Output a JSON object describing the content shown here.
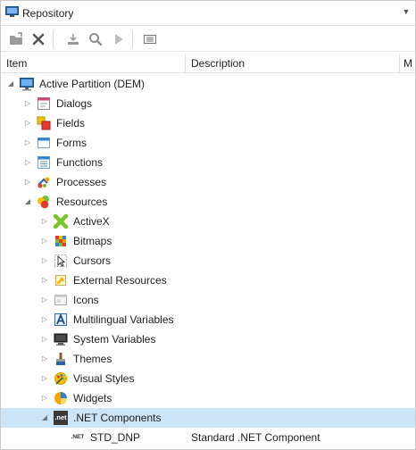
{
  "window": {
    "title": "Repository",
    "dropdown_icon": "chevron-down-icon"
  },
  "toolbar": {
    "buttons": [
      {
        "name": "new-item-button",
        "icon": "open-folder-icon"
      },
      {
        "name": "delete-button",
        "icon": "close-icon"
      },
      {
        "name": "import-button",
        "icon": "download-icon"
      },
      {
        "name": "find-button",
        "icon": "search-icon"
      },
      {
        "name": "run-button",
        "icon": "play-icon"
      },
      {
        "name": "properties-button",
        "icon": "list-icon"
      }
    ]
  },
  "columns": {
    "item": "Item",
    "description": "Description",
    "more": "M"
  },
  "tree": {
    "root": {
      "label": "Active Partition (DEM)",
      "icon": "monitor-icon",
      "expanded": true
    },
    "level1": [
      {
        "label": "Dialogs",
        "icon": "dialog-icon",
        "expanded": false
      },
      {
        "label": "Fields",
        "icon": "fields-icon",
        "expanded": false
      },
      {
        "label": "Forms",
        "icon": "form-icon",
        "expanded": false
      },
      {
        "label": "Functions",
        "icon": "functions-icon",
        "expanded": false
      },
      {
        "label": "Processes",
        "icon": "processes-icon",
        "expanded": false
      },
      {
        "label": "Resources",
        "icon": "resources-icon",
        "expanded": true
      }
    ],
    "resources": [
      {
        "label": "ActiveX",
        "icon": "activex-icon",
        "expanded": false
      },
      {
        "label": "Bitmaps",
        "icon": "bitmaps-icon",
        "expanded": false
      },
      {
        "label": "Cursors",
        "icon": "cursor-icon",
        "expanded": false
      },
      {
        "label": "External Resources",
        "icon": "external-resources-icon",
        "expanded": false
      },
      {
        "label": "Icons",
        "icon": "icons-icon",
        "expanded": false
      },
      {
        "label": "Multilingual Variables",
        "icon": "multilingual-icon",
        "expanded": false
      },
      {
        "label": "System Variables",
        "icon": "system-variables-icon",
        "expanded": false
      },
      {
        "label": "Themes",
        "icon": "themes-icon",
        "expanded": false
      },
      {
        "label": "Visual Styles",
        "icon": "visual-styles-icon",
        "expanded": false
      },
      {
        "label": "Widgets",
        "icon": "widgets-icon",
        "expanded": false
      },
      {
        "label": ".NET Components",
        "icon": "dotnet-icon",
        "expanded": true,
        "selected": true
      }
    ],
    "dotnet_items": [
      {
        "label": "STD_DNP",
        "description": "Standard .NET Component",
        "icon": "dotnet-icon",
        "icon_text": ".NET"
      }
    ],
    "dotnet_icon_text": ".net"
  },
  "colors": {
    "selection": "#cce4f7",
    "border": "#c9c9c9"
  }
}
